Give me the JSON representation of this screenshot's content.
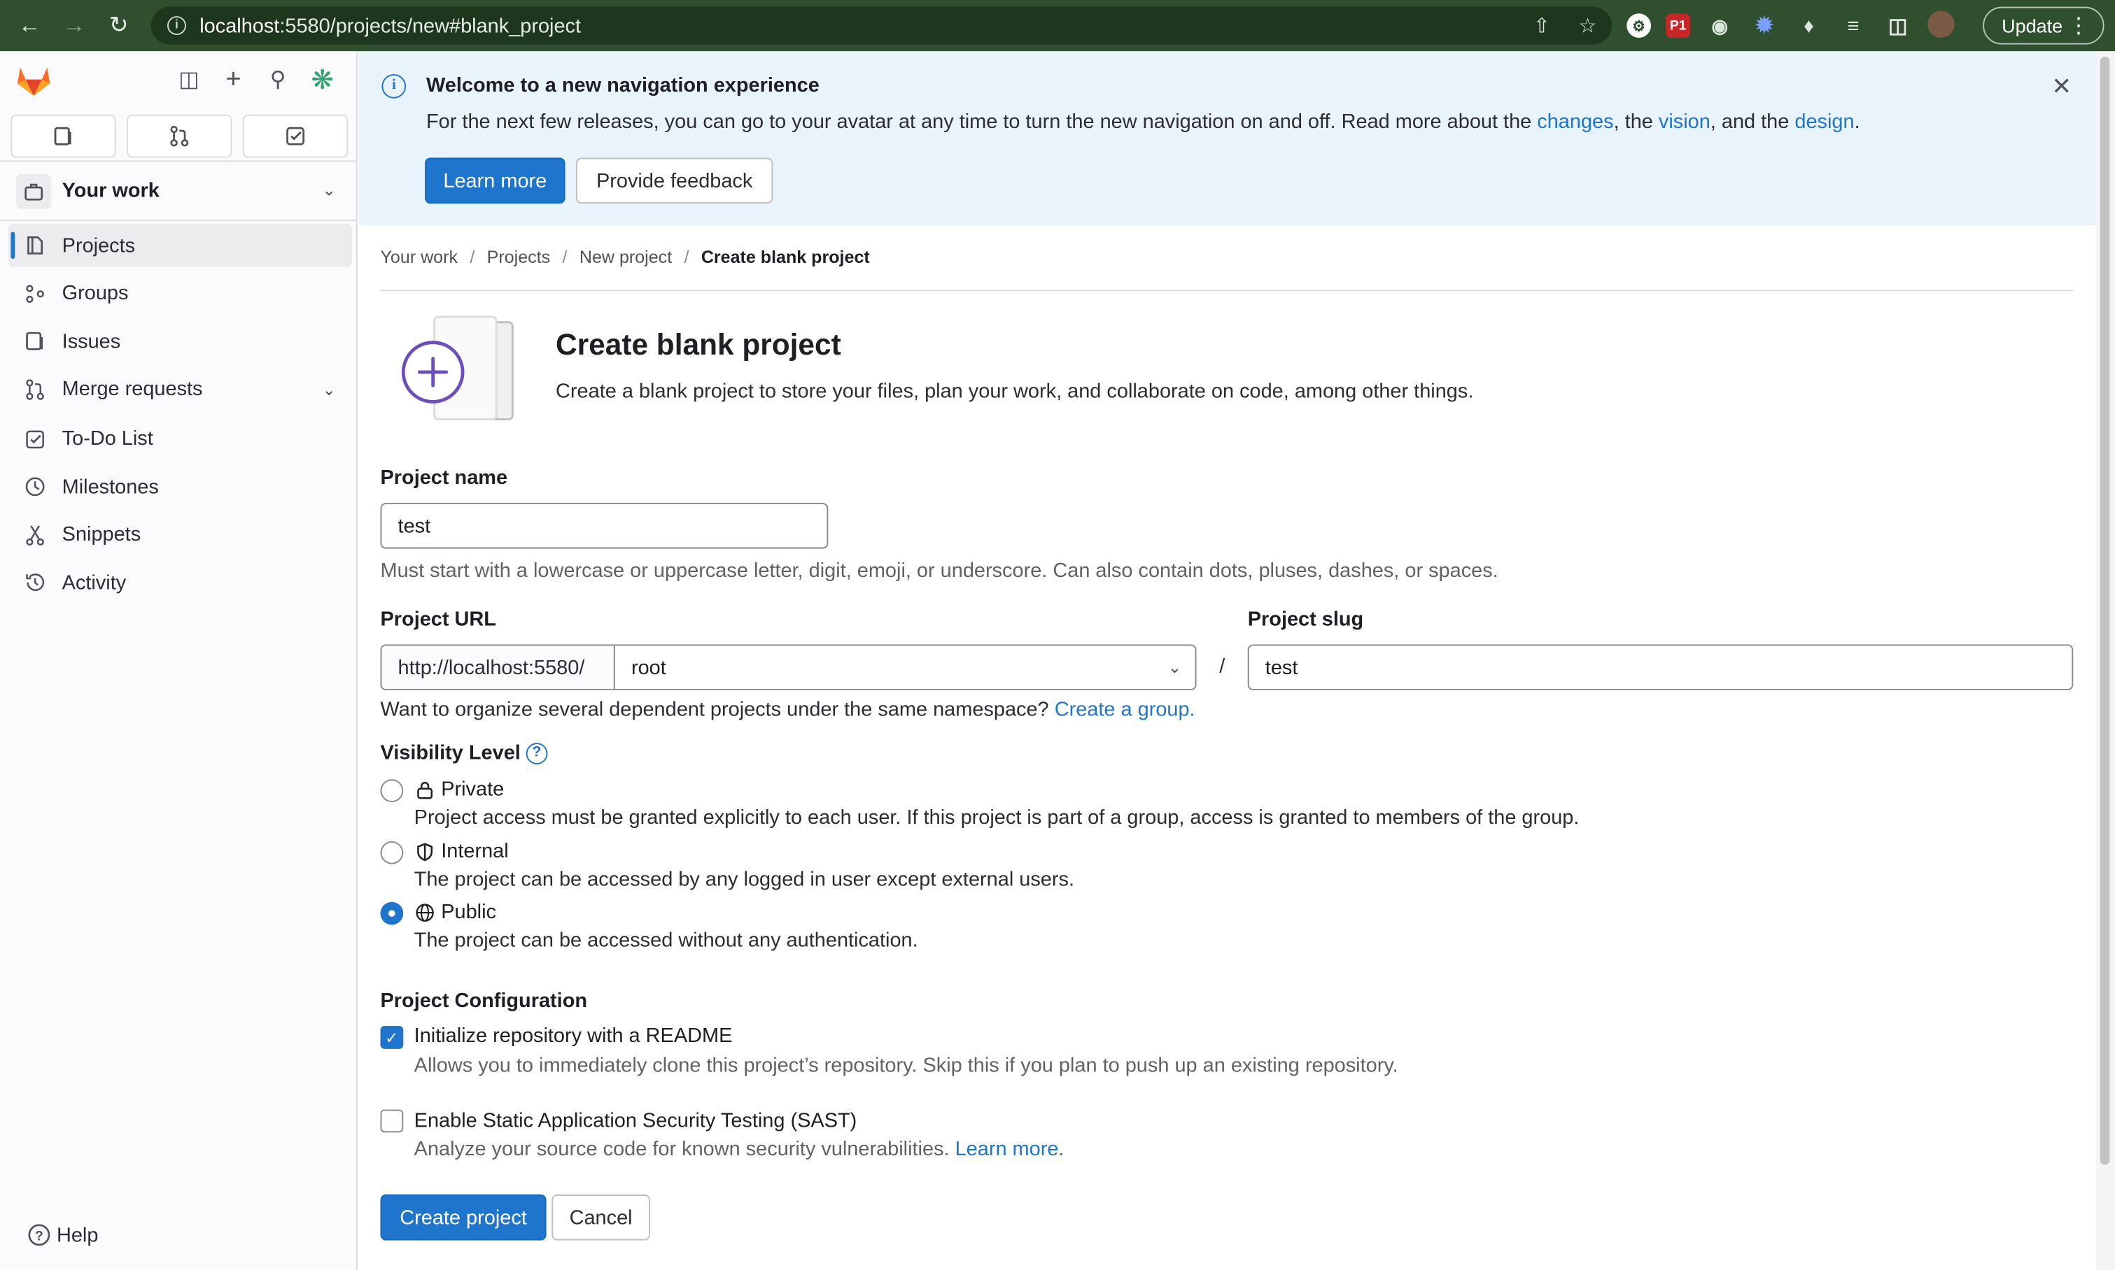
{
  "browser": {
    "url_host": "localhost",
    "url_rest": ":5580/projects/new#blank_project",
    "update_label": "Update",
    "ext_p1": "P1"
  },
  "sidebar": {
    "context_label": "Your work",
    "items": [
      {
        "label": "Projects",
        "icon": "project-icon"
      },
      {
        "label": "Groups",
        "icon": "group-icon"
      },
      {
        "label": "Issues",
        "icon": "issues-icon"
      },
      {
        "label": "Merge requests",
        "icon": "merge-request-icon"
      },
      {
        "label": "To-Do List",
        "icon": "todo-icon"
      },
      {
        "label": "Milestones",
        "icon": "clock-icon"
      },
      {
        "label": "Snippets",
        "icon": "snippet-icon"
      },
      {
        "label": "Activity",
        "icon": "history-icon"
      }
    ],
    "help_label": "Help"
  },
  "banner": {
    "title": "Welcome to a new navigation experience",
    "body_prefix": "For the next few releases, you can go to your avatar at any time to turn the new navigation on and off. Read more about the ",
    "link_changes": "changes",
    "sep1": ", the ",
    "link_vision": "vision",
    "sep2": ", and the ",
    "link_design": "design",
    "end": ".",
    "learn_more": "Learn more",
    "feedback": "Provide feedback"
  },
  "breadcrumb": [
    "Your work",
    "Projects",
    "New project",
    "Create blank project"
  ],
  "page": {
    "title": "Create blank project",
    "description": "Create a blank project to store your files, plan your work, and collaborate on code, among other things."
  },
  "form": {
    "name_label": "Project name",
    "name_value": "test",
    "name_hint": "Must start with a lowercase or uppercase letter, digit, emoji, or underscore. Can also contain dots, pluses, dashes, or spaces.",
    "url_label": "Project URL",
    "url_prefix": "http://localhost:5580/",
    "namespace": "root",
    "slash": "/",
    "slug_label": "Project slug",
    "slug_value": "test",
    "group_hint": "Want to organize several dependent projects under the same namespace?",
    "group_link": "Create a group.",
    "visibility_label": "Visibility Level",
    "visibility": [
      {
        "label": "Private",
        "desc": "Project access must be granted explicitly to each user. If this project is part of a group, access is granted to members of the group.",
        "selected": false
      },
      {
        "label": "Internal",
        "desc": "The project can be accessed by any logged in user except external users.",
        "selected": false
      },
      {
        "label": "Public",
        "desc": "The project can be accessed without any authentication.",
        "selected": true
      }
    ],
    "config_label": "Project Configuration",
    "readme_label": "Initialize repository with a README",
    "readme_desc": "Allows you to immediately clone this project’s repository. Skip this if you plan to push up an existing repository.",
    "readme_checked": true,
    "sast_label": "Enable Static Application Security Testing (SAST)",
    "sast_desc": "Analyze your source code for known security vulnerabilities.",
    "sast_link": "Learn more.",
    "sast_checked": false,
    "create_label": "Create project",
    "cancel_label": "Cancel"
  },
  "colors": {
    "accent": "#1f75cb",
    "chrome": "#2f4f2f",
    "banner_bg": "#e9f3fc"
  }
}
